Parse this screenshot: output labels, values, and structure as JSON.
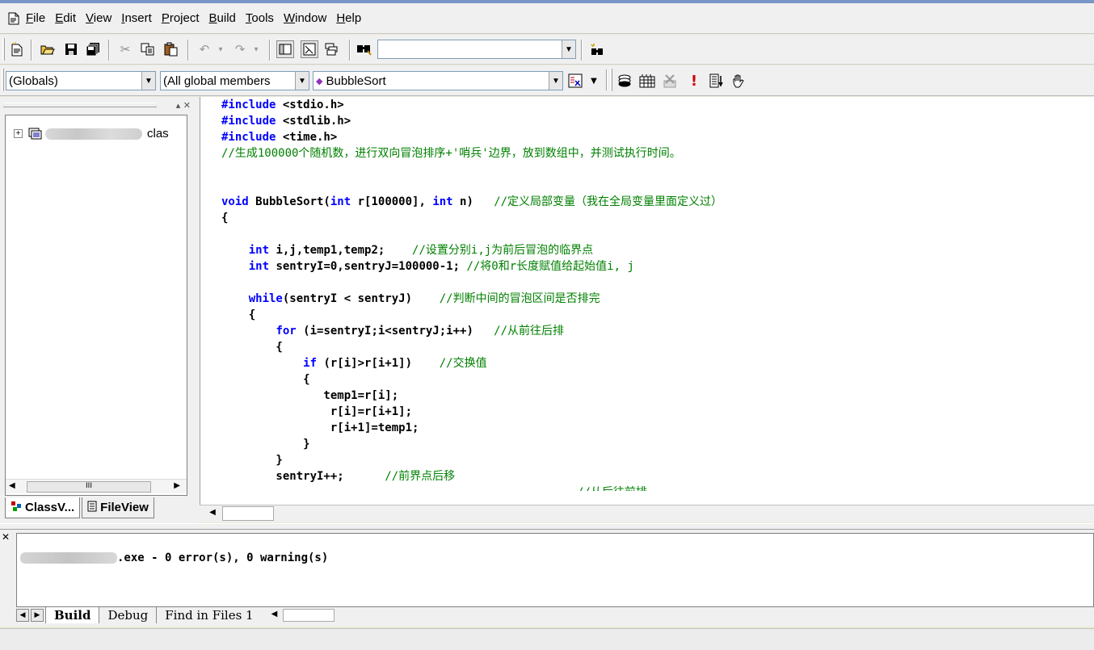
{
  "menu": {
    "items": [
      "File",
      "Edit",
      "View",
      "Insert",
      "Project",
      "Build",
      "Tools",
      "Window",
      "Help"
    ]
  },
  "toolbar1": {
    "find_value": "",
    "icons": [
      "new-text-file-icon",
      "open-icon",
      "save-icon",
      "save-all-icon",
      "cut-icon",
      "copy-icon",
      "paste-icon",
      "undo-icon",
      "redo-icon",
      "workspace-icon",
      "output-icon",
      "window-list-icon",
      "find-in-files-icon",
      "find-icon"
    ]
  },
  "toolbar2": {
    "scope_combo": "(Globals)",
    "members_combo": "(All global members",
    "function_combo": "BubbleSort",
    "icons": [
      "wizard-action-icon",
      "compile-icon",
      "build-icon",
      "stop-build-icon",
      "execute-icon",
      "go-icon",
      "insert-breakpoint-icon"
    ]
  },
  "workspace": {
    "tree_item_suffix": "clas",
    "tabs": [
      "ClassV...",
      "FileView"
    ]
  },
  "editor": {
    "lines": [
      [
        {
          "t": "#include ",
          "c": "pp"
        },
        {
          "t": "<stdio.h>",
          "c": ""
        }
      ],
      [
        {
          "t": "#include ",
          "c": "pp"
        },
        {
          "t": "<stdlib.h>",
          "c": ""
        }
      ],
      [
        {
          "t": "#include ",
          "c": "pp"
        },
        {
          "t": "<time.h>",
          "c": ""
        }
      ],
      [
        {
          "t": "//生成100000个随机数，进行双向冒泡排序+'哨兵'边界，放到数组中，并测试执行时间。",
          "c": "cm"
        }
      ],
      [
        {
          "t": "",
          "c": ""
        }
      ],
      [
        {
          "t": "",
          "c": ""
        }
      ],
      [
        {
          "t": "void",
          "c": "kw"
        },
        {
          "t": " BubbleSort(",
          "c": ""
        },
        {
          "t": "int",
          "c": "kw"
        },
        {
          "t": " r[100000], ",
          "c": ""
        },
        {
          "t": "int",
          "c": "kw"
        },
        {
          "t": " n)   ",
          "c": ""
        },
        {
          "t": "//定义局部变量（我在全局变量里面定义过）",
          "c": "cm"
        }
      ],
      [
        {
          "t": "{",
          "c": ""
        }
      ],
      [
        {
          "t": "",
          "c": ""
        }
      ],
      [
        {
          "t": "    ",
          "c": ""
        },
        {
          "t": "int",
          "c": "kw"
        },
        {
          "t": " i,j,temp1,temp2;    ",
          "c": ""
        },
        {
          "t": "//设置分别i,j为前后冒泡的临界点",
          "c": "cm"
        }
      ],
      [
        {
          "t": "    ",
          "c": ""
        },
        {
          "t": "int",
          "c": "kw"
        },
        {
          "t": " sentryI=0,sentryJ=100000-1; ",
          "c": ""
        },
        {
          "t": "//将0和r长度赋值给起始值i, j",
          "c": "cm"
        }
      ],
      [
        {
          "t": "",
          "c": ""
        }
      ],
      [
        {
          "t": "    ",
          "c": ""
        },
        {
          "t": "while",
          "c": "kw"
        },
        {
          "t": "(sentryI < sentryJ)    ",
          "c": ""
        },
        {
          "t": "//判断中间的冒泡区间是否排完",
          "c": "cm"
        }
      ],
      [
        {
          "t": "    {",
          "c": ""
        }
      ],
      [
        {
          "t": "        ",
          "c": ""
        },
        {
          "t": "for",
          "c": "kw"
        },
        {
          "t": " (i=sentryI;i<sentryJ;i++)   ",
          "c": ""
        },
        {
          "t": "//从前往后排",
          "c": "cm"
        }
      ],
      [
        {
          "t": "        {",
          "c": ""
        }
      ],
      [
        {
          "t": "            ",
          "c": ""
        },
        {
          "t": "if",
          "c": "kw"
        },
        {
          "t": " (r[i]>r[i+1])    ",
          "c": ""
        },
        {
          "t": "//交换值",
          "c": "cm"
        }
      ],
      [
        {
          "t": "            {",
          "c": ""
        }
      ],
      [
        {
          "t": "               temp1=r[i];",
          "c": ""
        }
      ],
      [
        {
          "t": "                r[i]=r[i+1];",
          "c": ""
        }
      ],
      [
        {
          "t": "                r[i+1]=temp1;",
          "c": ""
        }
      ],
      [
        {
          "t": "            }",
          "c": ""
        }
      ],
      [
        {
          "t": "        }",
          "c": ""
        }
      ],
      [
        {
          "t": "        sentryI++;      ",
          "c": ""
        },
        {
          "t": "//前界点后移",
          "c": "cm"
        }
      ]
    ],
    "partial_line_comment": "//从后往前排"
  },
  "output": {
    "message": ".exe - 0 error(s), 0 warning(s)",
    "tabs": [
      "Build",
      "Debug",
      "Find in Files 1"
    ]
  },
  "colors": {
    "keyword": "#0000ff",
    "comment": "#008000"
  }
}
